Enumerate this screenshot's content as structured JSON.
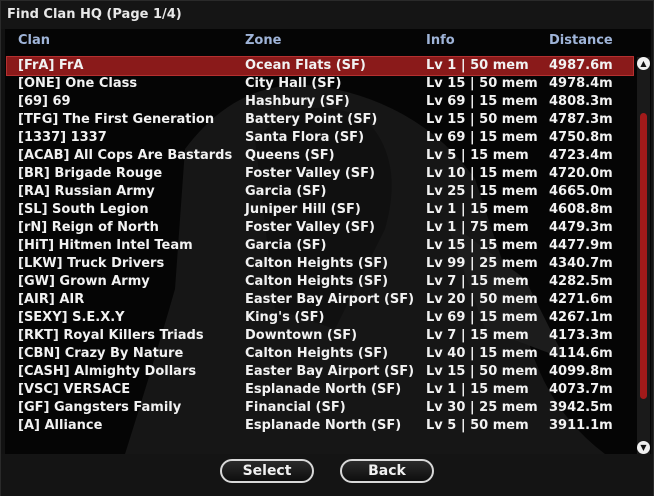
{
  "window": {
    "title": "Find Clan HQ (Page 1/4)"
  },
  "columns": {
    "clan": "Clan",
    "zone": "Zone",
    "info": "Info",
    "distance": "Distance"
  },
  "rows": [
    {
      "clan": "[FrA] FrA",
      "zone": "Ocean Flats (SF)",
      "info": "Lv 1 | 50 mem",
      "distance": "4987.6m",
      "selected": true
    },
    {
      "clan": "[ONE] One Class",
      "zone": "City Hall (SF)",
      "info": "Lv 15 | 50 mem",
      "distance": "4978.4m"
    },
    {
      "clan": "[69] 69",
      "zone": "Hashbury (SF)",
      "info": "Lv 69 | 15 mem",
      "distance": "4808.3m"
    },
    {
      "clan": "[TFG] The First Generation",
      "zone": "Battery Point (SF)",
      "info": "Lv 15 | 50 mem",
      "distance": "4787.3m"
    },
    {
      "clan": "[1337] 1337",
      "zone": "Santa Flora (SF)",
      "info": "Lv 69 | 15 mem",
      "distance": "4750.8m"
    },
    {
      "clan": "[ACAB] All Cops Are Bastards",
      "zone": "Queens (SF)",
      "info": "Lv 5 | 15 mem",
      "distance": "4723.4m"
    },
    {
      "clan": "[BR] Brigade Rouge",
      "zone": "Foster Valley (SF)",
      "info": "Lv 10 | 15 mem",
      "distance": "4720.0m"
    },
    {
      "clan": "[RA] Russian Army",
      "zone": "Garcia (SF)",
      "info": "Lv 25 | 15 mem",
      "distance": "4665.0m"
    },
    {
      "clan": "[SL] South Legion",
      "zone": "Juniper Hill (SF)",
      "info": "Lv 1 | 15 mem",
      "distance": "4608.8m"
    },
    {
      "clan": "[rN] Reign of North",
      "zone": "Foster Valley (SF)",
      "info": "Lv 1 | 75 mem",
      "distance": "4479.3m"
    },
    {
      "clan": "[HiT] Hitmen Intel Team",
      "zone": "Garcia (SF)",
      "info": "Lv 15 | 15 mem",
      "distance": "4477.9m"
    },
    {
      "clan": "[LKW] Truck Drivers",
      "zone": "Calton Heights (SF)",
      "info": "Lv 99 | 25 mem",
      "distance": "4340.7m"
    },
    {
      "clan": "[GW] Grown Army",
      "zone": "Calton Heights (SF)",
      "info": "Lv 7 | 15 mem",
      "distance": "4282.5m"
    },
    {
      "clan": "[AIR] AIR",
      "zone": "Easter Bay Airport (SF)",
      "info": "Lv 20 | 50 mem",
      "distance": "4271.6m"
    },
    {
      "clan": "[SEXY] S.E.X.Y",
      "zone": "King's (SF)",
      "info": "Lv 69 | 15 mem",
      "distance": "4267.1m"
    },
    {
      "clan": "[RKT] Royal Killers Triads",
      "zone": "Downtown (SF)",
      "info": "Lv 7 | 15 mem",
      "distance": "4173.3m"
    },
    {
      "clan": "[CBN] Crazy By Nature",
      "zone": "Calton Heights (SF)",
      "info": "Lv 40 | 15 mem",
      "distance": "4114.6m"
    },
    {
      "clan": "[CASH] Almighty Dollars",
      "zone": "Easter Bay Airport (SF)",
      "info": "Lv 15 | 50 mem",
      "distance": "4099.8m"
    },
    {
      "clan": "[VSC] VERSACE",
      "zone": "Esplanade North (SF)",
      "info": "Lv 1 | 15 mem",
      "distance": "4073.7m"
    },
    {
      "clan": "[GF] Gangsters Family",
      "zone": "Financial (SF)",
      "info": "Lv 30 | 25 mem",
      "distance": "3942.5m"
    },
    {
      "clan": "[A] Alliance",
      "zone": "Esplanade North (SF)",
      "info": "Lv 5 | 50 mem",
      "distance": "3911.1m"
    }
  ],
  "scrollbar": {
    "up_icon": "triangle-up-icon",
    "down_icon": "triangle-down-icon",
    "thumb_color": "#a11a1a"
  },
  "buttons": {
    "select": "Select",
    "back": "Back"
  },
  "colors": {
    "selected_row": "#8a1a1a",
    "header_text": "#9fb4d8",
    "row_text": "#f2f2f2"
  }
}
